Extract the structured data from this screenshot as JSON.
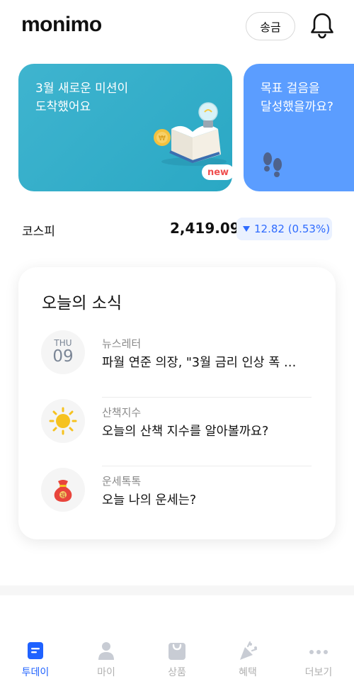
{
  "app": {
    "logo": "monimo",
    "send_label": "송금"
  },
  "icons": {
    "bell": "bell-icon",
    "book": "book-illustration-icon",
    "footprints": "footprints-icon"
  },
  "cards": [
    {
      "title": "3월 새로운 미션이\n도착했어요",
      "badge": "new",
      "color": "#37aecb"
    },
    {
      "title": "목표 걸음을\n달성했을까요?",
      "color": "#5b9dff"
    }
  ],
  "kospi": {
    "label": "코스피",
    "value": "2,419.09",
    "change": "12.82 (0.53%)",
    "direction": "down",
    "change_color": "#2e6bff"
  },
  "news": {
    "title": "오늘의 소식",
    "items": [
      {
        "type": "date",
        "dow": "THU",
        "day": "09",
        "category": "뉴스레터",
        "headline": "파월 연준 의장, \"3월 금리 인상 폭 …"
      },
      {
        "type": "sun",
        "icon": "sun-icon",
        "category": "산책지수",
        "headline": "오늘의 산책 지수를 알아볼까요?"
      },
      {
        "type": "fortune",
        "icon": "fortune-bag-icon",
        "category": "운세톡톡",
        "headline": "오늘 나의 운세는?"
      }
    ]
  },
  "tabs": [
    {
      "label": "투데이",
      "icon": "today-icon",
      "active": true
    },
    {
      "label": "마이",
      "icon": "person-icon",
      "active": false
    },
    {
      "label": "상품",
      "icon": "shopping-bag-icon",
      "active": false
    },
    {
      "label": "혜택",
      "icon": "party-popper-icon",
      "active": false
    },
    {
      "label": "더보기",
      "icon": "more-dots-icon",
      "active": false
    }
  ],
  "colors": {
    "accent": "#1f62ff",
    "inactive_tab": "#c8ccd4"
  }
}
